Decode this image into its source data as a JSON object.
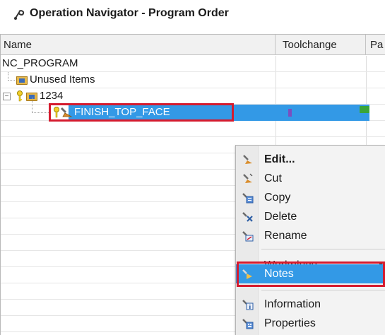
{
  "window": {
    "title": "Operation Navigator - Program Order"
  },
  "columns": [
    "Name",
    "Toolchange",
    "Pa"
  ],
  "tree": {
    "root": "NC_PROGRAM",
    "unused": "Unused Items",
    "group": "1234",
    "group_expander": "−",
    "operation": "FINISH_TOP_FACE"
  },
  "context_menu": {
    "items": [
      {
        "label": "Edit...",
        "icon": "edit-icon",
        "bold": true
      },
      {
        "label": "Cut",
        "icon": "cut-icon"
      },
      {
        "label": "Copy",
        "icon": "copy-icon"
      },
      {
        "label": "Delete",
        "icon": "delete-icon"
      },
      {
        "label": "Rename",
        "icon": "rename-icon"
      },
      {
        "label": "Workpiece",
        "icon": "none",
        "submenu": true
      },
      {
        "label": "Notes",
        "icon": "notes-icon",
        "highlighted": true
      },
      {
        "label": "Information",
        "icon": "information-icon"
      },
      {
        "label": "Properties",
        "icon": "properties-icon"
      }
    ]
  },
  "colors": {
    "selection": "#3399e6",
    "highlight_outline": "#d51b2e",
    "menu_background": "#f3f3f3"
  }
}
